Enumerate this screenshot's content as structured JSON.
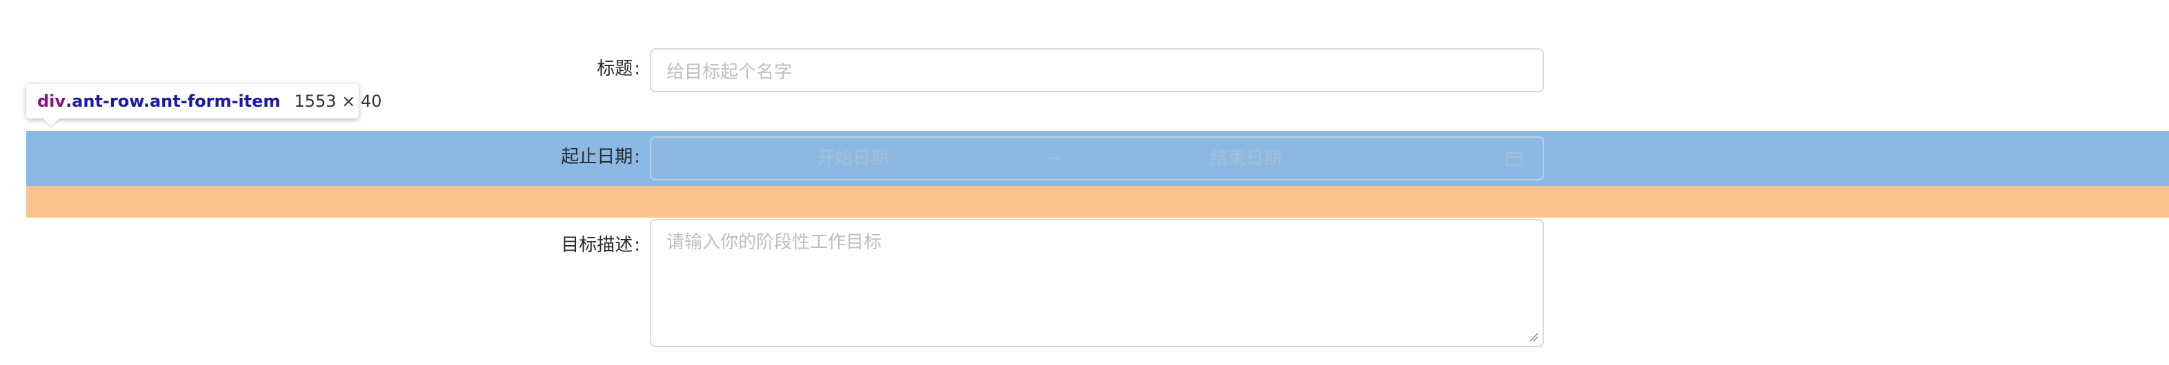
{
  "form": {
    "title": {
      "label": "标题",
      "colon": ":",
      "placeholder": "给目标起个名字"
    },
    "date_range": {
      "label": "起止日期",
      "colon": ":",
      "start_placeholder": "开始日期",
      "separator": "~",
      "end_placeholder": "结束日期",
      "icon": "calendar-icon"
    },
    "description": {
      "label": "目标描述",
      "colon": ":",
      "placeholder": "请输入你的阶段性工作目标"
    }
  },
  "devtools_tooltip": {
    "tag": "div",
    "classes": ".ant-row.ant-form-item",
    "dimensions": "1553 × 40"
  },
  "colors": {
    "highlight_content": "#6fa8dc",
    "highlight_margin": "#f6b26b",
    "placeholder": "#bfbfbf",
    "border": "#d9d9d9"
  }
}
